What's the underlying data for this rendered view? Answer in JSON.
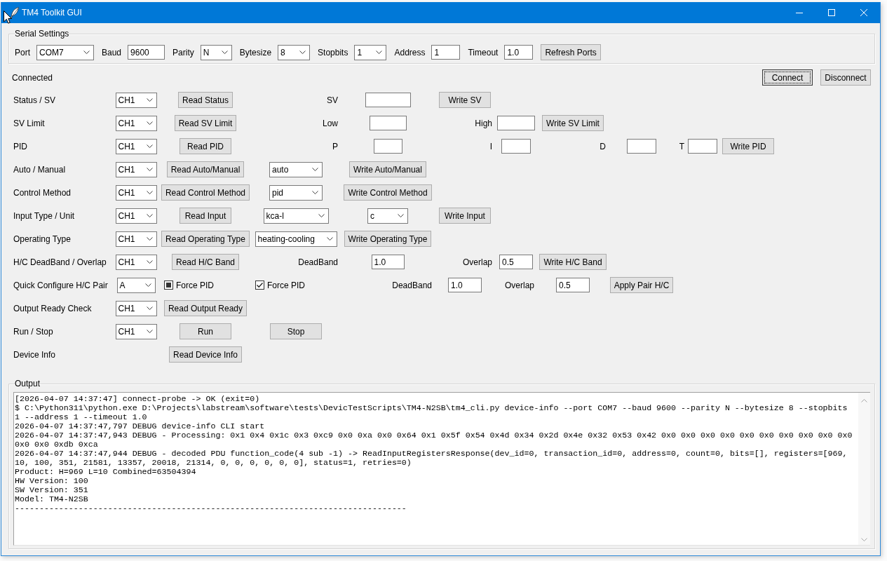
{
  "window": {
    "title": "TM4 Toolkit GUI"
  },
  "serial_settings": {
    "title": "Serial Settings",
    "fields": [
      {
        "label": "Port",
        "kind": "combo",
        "value": "COM7"
      },
      {
        "label": "Baud",
        "kind": "entry",
        "value": "9600"
      },
      {
        "label": "Parity",
        "kind": "combo",
        "value": "N"
      },
      {
        "label": "Bytesize",
        "kind": "combo",
        "value": "8"
      },
      {
        "label": "Stopbits",
        "kind": "combo",
        "value": "1"
      },
      {
        "label": "Address",
        "kind": "entry",
        "value": "1"
      },
      {
        "label": "Timeout",
        "kind": "entry",
        "value": "1.0"
      }
    ],
    "refresh_button": "Refresh Ports"
  },
  "connection": {
    "status": "Connected",
    "buttons": [
      {
        "label": "Connect",
        "focused": true
      },
      {
        "label": "Disconnect",
        "focused": false
      }
    ]
  },
  "commands": [
    {
      "label": "Status / SV",
      "selector": "CH1",
      "controls": [
        {
          "kind": "button",
          "label": "Read Status"
        },
        {
          "kind": "text",
          "label": "SV"
        },
        {
          "kind": "entry"
        },
        {
          "kind": "button",
          "label": "Write SV"
        }
      ]
    },
    {
      "label": "SV Limit",
      "selector": "CH1",
      "controls": [
        {
          "kind": "button",
          "label": "Read SV Limit"
        },
        {
          "kind": "text",
          "label": "Low"
        },
        {
          "kind": "entry"
        },
        {
          "kind": "text",
          "label": "High"
        },
        {
          "kind": "entry"
        },
        {
          "kind": "button",
          "label": "Write SV Limit"
        }
      ]
    },
    {
      "label": "PID",
      "selector": "CH1",
      "controls": [
        {
          "kind": "button",
          "label": "Read PID"
        },
        {
          "kind": "text",
          "label": "P"
        },
        {
          "kind": "entry"
        },
        {
          "kind": "text",
          "label": "I"
        },
        {
          "kind": "entry"
        },
        {
          "kind": "text",
          "label": "D"
        },
        {
          "kind": "entry"
        },
        {
          "kind": "text",
          "label": "T"
        },
        {
          "kind": "entry"
        },
        {
          "kind": "button",
          "label": "Write PID"
        }
      ]
    },
    {
      "label": "Auto / Manual",
      "selector": "CH1",
      "controls": [
        {
          "kind": "button",
          "label": "Read Auto/Manual"
        },
        {
          "kind": "combo",
          "value": "auto"
        },
        {
          "kind": "button",
          "label": "Write Auto/Manual"
        }
      ]
    },
    {
      "label": "Control Method",
      "selector": "CH1",
      "controls": [
        {
          "kind": "button",
          "label": "Read Control Method"
        },
        {
          "kind": "combo",
          "value": "pid"
        },
        {
          "kind": "button",
          "label": "Write Control Method"
        }
      ]
    },
    {
      "label": "Input Type / Unit",
      "selector": "CH1",
      "controls": [
        {
          "kind": "button",
          "label": "Read Input"
        },
        {
          "kind": "combo",
          "value": "kca-l"
        },
        {
          "kind": "combo",
          "value": "c"
        },
        {
          "kind": "button",
          "label": "Write Input"
        }
      ]
    },
    {
      "label": "Operating Type",
      "selector": "CH1",
      "controls": [
        {
          "kind": "button",
          "label": "Read Operating Type"
        },
        {
          "kind": "combo",
          "value": "heating-cooling"
        },
        {
          "kind": "button",
          "label": "Write Operating Type"
        }
      ]
    },
    {
      "label": "H/C DeadBand / Overlap",
      "selector": "CH1",
      "controls": [
        {
          "kind": "button",
          "label": "Read H/C Band"
        },
        {
          "kind": "text",
          "label": "DeadBand"
        },
        {
          "kind": "entry",
          "value": "1.0"
        },
        {
          "kind": "text",
          "label": "Overlap"
        },
        {
          "kind": "entry",
          "value": "0.5"
        },
        {
          "kind": "button",
          "label": "Write H/C Band"
        }
      ]
    },
    {
      "label": "Quick Configure H/C Pair",
      "selector": "A",
      "controls": [
        {
          "kind": "checkbox",
          "label": "Force PID",
          "checked": false,
          "indeterminate": true
        },
        {
          "kind": "checkbox",
          "label": "Force PID",
          "checked": true,
          "indeterminate": false
        },
        {
          "kind": "text",
          "label": "DeadBand"
        },
        {
          "kind": "entry",
          "value": "1.0"
        },
        {
          "kind": "text",
          "label": "Overlap"
        },
        {
          "kind": "entry",
          "value": "0.5"
        },
        {
          "kind": "button",
          "label": "Apply Pair H/C"
        }
      ]
    },
    {
      "label": "Output Ready Check",
      "selector": "CH1",
      "controls": [
        {
          "kind": "button",
          "label": "Read Output Ready"
        }
      ]
    },
    {
      "label": "Run / Stop",
      "selector": "CH1",
      "controls": [
        {
          "kind": "button",
          "label": "Run"
        },
        {
          "kind": "button",
          "label": "Stop"
        }
      ]
    },
    {
      "label": "Device Info",
      "controls": [
        {
          "kind": "button",
          "label": "Read Device Info"
        }
      ]
    }
  ],
  "output": {
    "title": "Output",
    "lines": [
      "[2026-04-07 14:37:47] connect-probe -> OK (exit=0)",
      "$ C:\\Python311\\python.exe D:\\Projects\\labstream\\software\\tests\\DevicTestScripts\\TM4-N2SB\\tm4_cli.py device-info --port COM7 --baud 9600 --parity N --bytesize 8 --stopbits",
      "1 --address 1 --timeout 1.0",
      "2026-04-07 14:37:47,797 DEBUG device-info CLI start",
      "2026-04-07 14:37:47,943 DEBUG - Processing: 0x1 0x4 0x1c 0x3 0xc9 0x0 0xa 0x0 0x64 0x1 0x5f 0x54 0x4d 0x34 0x2d 0x4e 0x32 0x53 0x42 0x0 0x0 0x0 0x0 0x0 0x0 0x0 0x0 0x0 0x0",
      "0x0 0x0 0xdb 0xca",
      "2026-04-07 14:37:47,944 DEBUG - decoded PDU function_code(4 sub -1) -> ReadInputRegistersResponse(dev_id=0, transaction_id=0, address=0, count=0, bits=[], registers=[969,",
      "10, 100, 351, 21581, 13357, 20018, 21314, 0, 0, 0, 0, 0, 0], status=1, retries=0)",
      "Product: H=969 L=10 Combined=63504394",
      "HW Version: 100",
      "SW Version: 351",
      "Model: TM4-N2SB",
      "--------------------------------------------------------------------------------"
    ]
  }
}
